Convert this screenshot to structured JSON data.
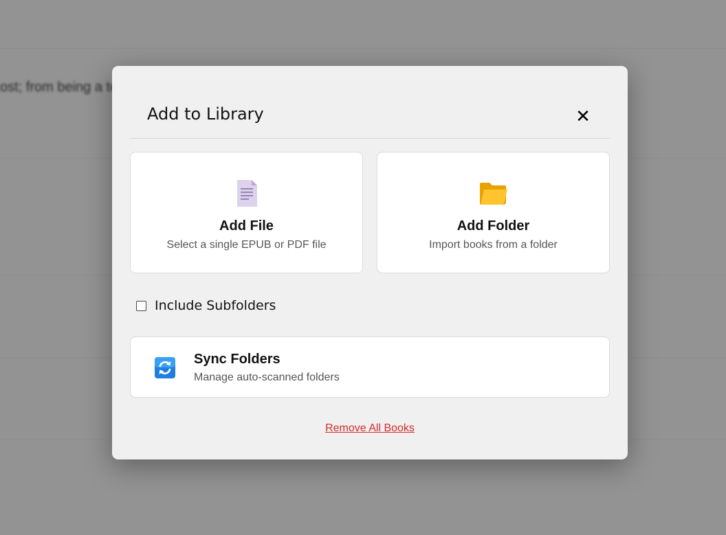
{
  "background": {
    "text": "ost; from being a te"
  },
  "dialog": {
    "title": "Add to Library",
    "close_glyph": "✕",
    "close_icon": "close-icon"
  },
  "options": {
    "add_file": {
      "title": "Add File",
      "subtitle": "Select a single EPUB or PDF file",
      "icon": "document-icon"
    },
    "add_folder": {
      "title": "Add Folder",
      "subtitle": "Import books from a folder",
      "icon": "folder-icon"
    }
  },
  "include_subfolders": {
    "label": "Include Subfolders",
    "checked": false
  },
  "sync": {
    "title": "Sync Folders",
    "subtitle": "Manage auto-scanned folders",
    "icon": "sync-icon"
  },
  "remove_all": {
    "label": "Remove All Books"
  },
  "colors": {
    "danger": "#d52a2a",
    "folder": "#f5b400",
    "sync": "#1e7fe0",
    "document": "#dcd2ec"
  }
}
